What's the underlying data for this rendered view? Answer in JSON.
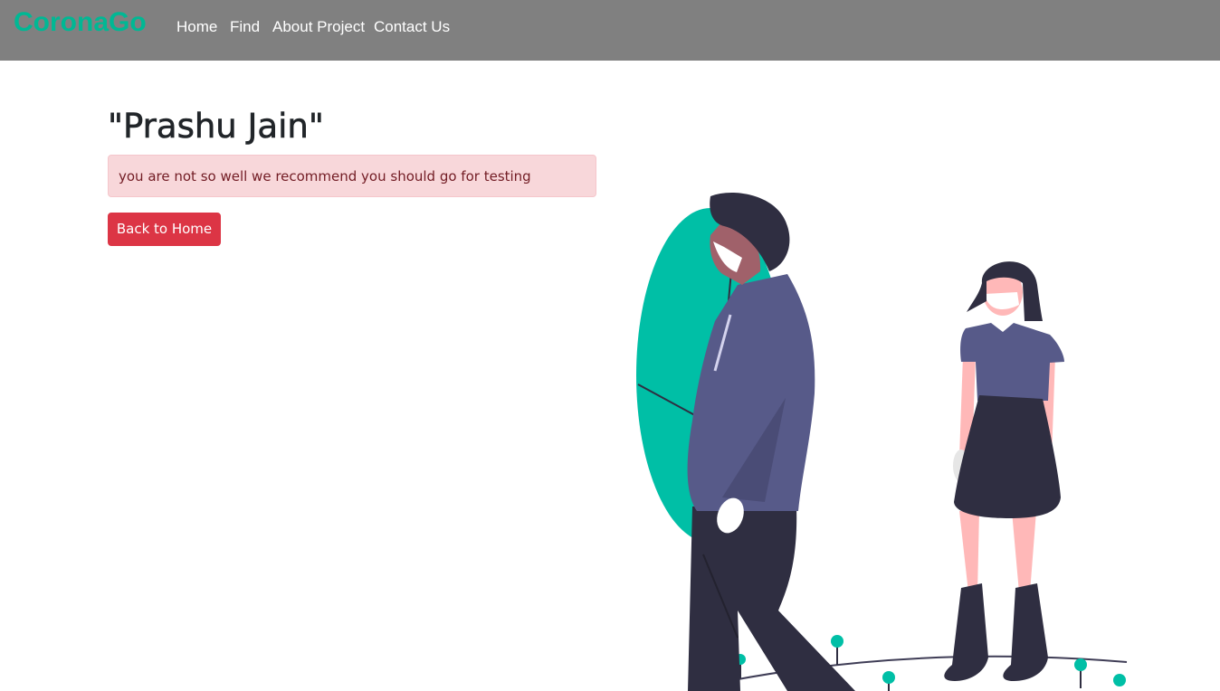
{
  "navbar": {
    "brand": "CoronaGo",
    "links": [
      "Home",
      "Find",
      "About Project",
      "Contact Us"
    ]
  },
  "main": {
    "title": "\"Prashu Jain\"",
    "alert_text": "you are not so well we recommend you should go for testing",
    "back_button_label": "Back to Home"
  },
  "illustration": {
    "icon": "people-wearing-masks-illustration",
    "colors": {
      "accent": "#00bfa6",
      "jacket": "#575a89",
      "dark": "#2f2e41",
      "skin_dark": "#a0616a",
      "skin_light": "#ffb8b8",
      "mask": "#ffffff"
    }
  },
  "colors": {
    "navbar_bg": "#808080",
    "brand": "#00b894",
    "alert_bg": "#f8d7da",
    "alert_text": "#721c24",
    "button_bg": "#dc3545"
  }
}
